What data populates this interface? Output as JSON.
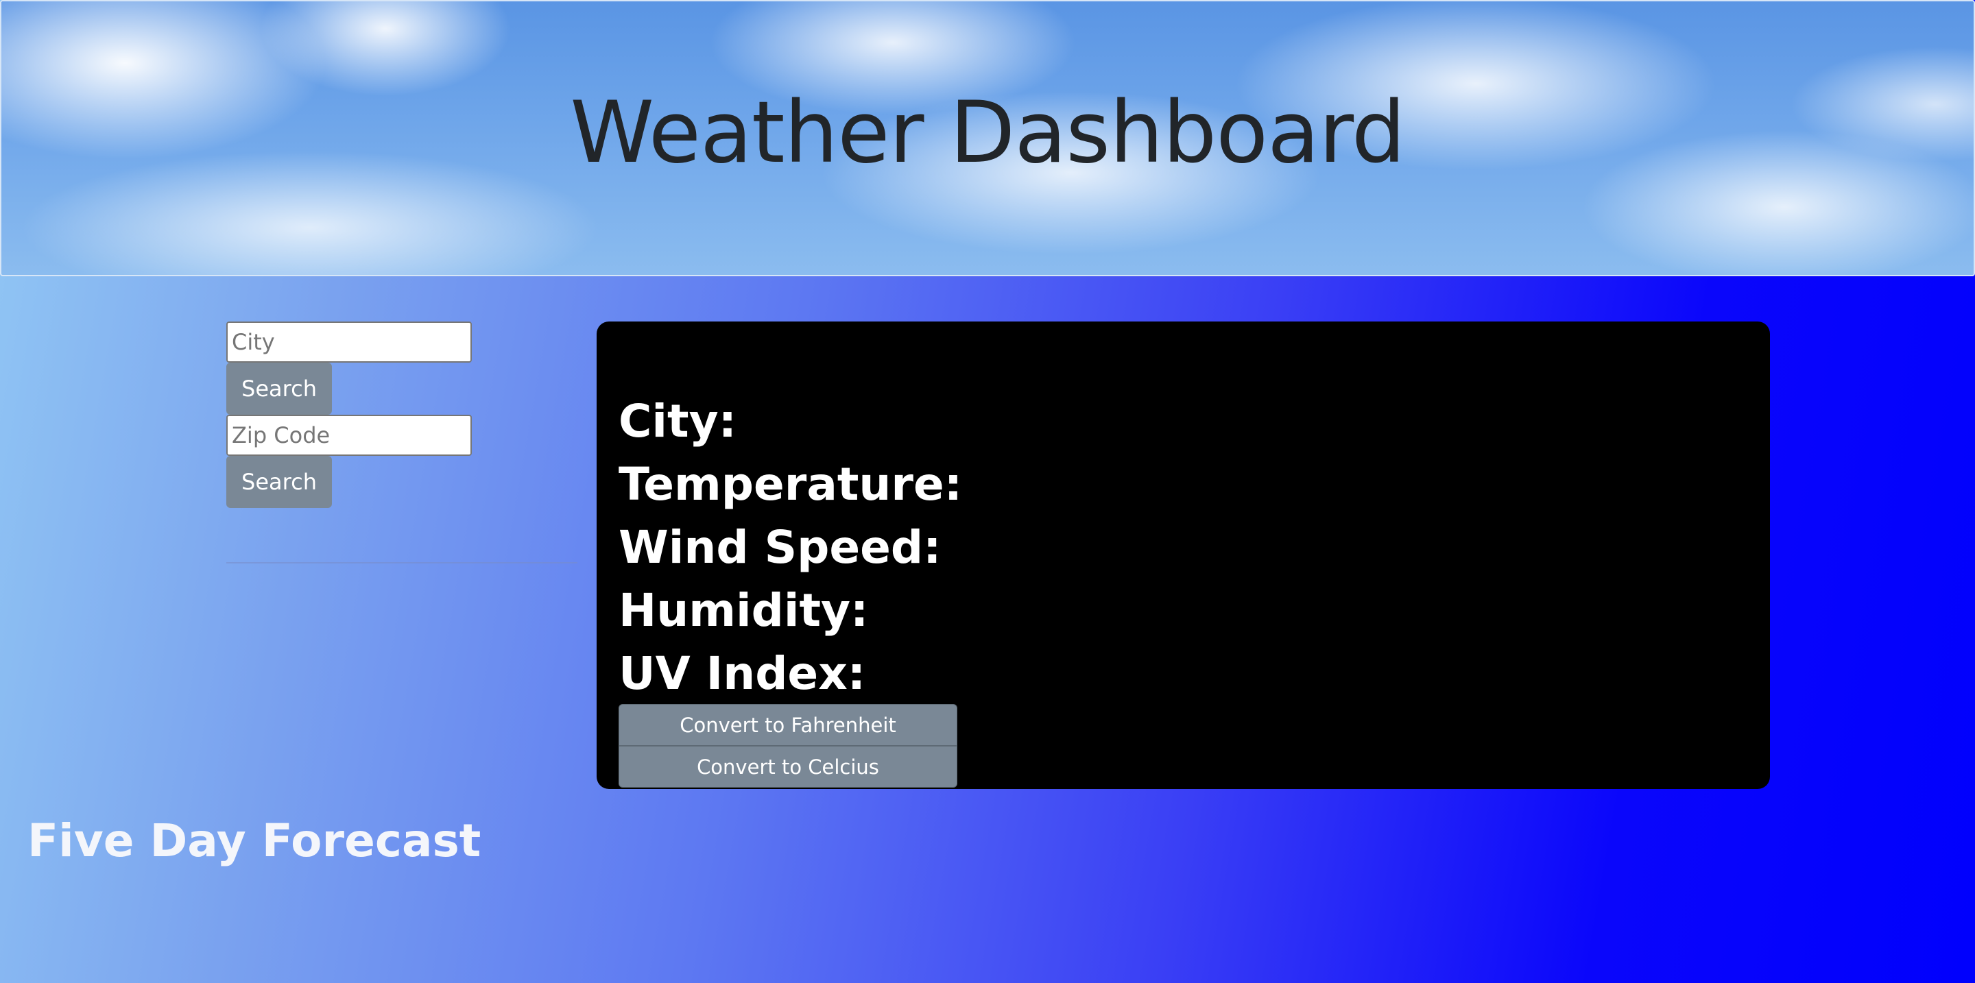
{
  "header": {
    "title": "Weather Dashboard"
  },
  "search": {
    "city_placeholder": "City",
    "city_button_label": "Search",
    "zip_placeholder": "Zip Code",
    "zip_button_label": "Search"
  },
  "current_weather": {
    "fields": [
      {
        "label": "City:"
      },
      {
        "label": "Temperature:"
      },
      {
        "label": "Wind Speed:"
      },
      {
        "label": "Humidity:"
      },
      {
        "label": "UV Index:"
      }
    ],
    "convert_fahrenheit_label": "Convert to Fahrenheit",
    "convert_celcius_label": "Convert to Celcius"
  },
  "forecast": {
    "title": "Five Day Forecast"
  },
  "colors": {
    "card_background": "#000000",
    "button_background": "#7a8896",
    "gradient_start": "#92c8f4",
    "gradient_end": "#0000fd",
    "title_color": "#212529"
  }
}
